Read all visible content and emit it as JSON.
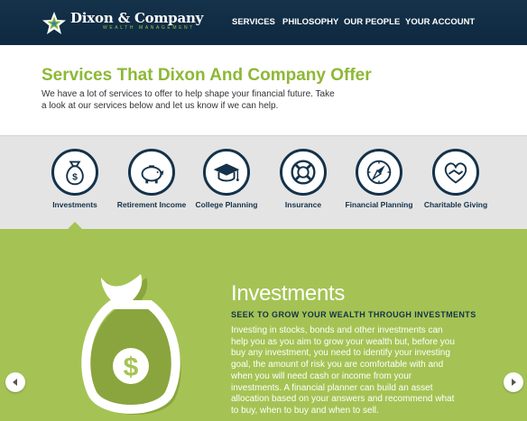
{
  "brand": {
    "name": "Dixon & Company",
    "tagline": "WEALTH MANAGEMENT"
  },
  "nav": {
    "items": [
      "SERVICES",
      "PHILOSOPHY",
      "OUR PEOPLE",
      "YOUR ACCOUNT"
    ]
  },
  "intro": {
    "title": "Services That Dixon And Company Offer",
    "text": "We have a lot of services to offer to help shape your financial future. Take a look at our services below and let us know if we can help."
  },
  "services": [
    {
      "label": "Investments",
      "icon": "money-bag-icon"
    },
    {
      "label": "Retirement Income",
      "icon": "piggy-bank-icon"
    },
    {
      "label": "College Planning",
      "icon": "graduation-cap-icon"
    },
    {
      "label": "Insurance",
      "icon": "life-ring-icon"
    },
    {
      "label": "Financial Planning",
      "icon": "compass-icon"
    },
    {
      "label": "Charitable Giving",
      "icon": "heart-hand-icon"
    }
  ],
  "feature": {
    "title": "Investments",
    "subtitle": "SEEK TO GROW YOUR WEALTH THROUGH INVESTMENTS",
    "body": "Investing in stocks, bonds and other investments can help you as you aim to grow your wealth but, before you buy any investment, you need to identify your investing goal, the amount of risk you are comfortable with and when you will need cash or income from your investments.  A financial planner can build an asset allocation based on your answers and recommend what to buy, when to buy and when to sell."
  },
  "colors": {
    "navy": "#14324a",
    "green": "#a5c354",
    "accent_green": "#8db836"
  }
}
